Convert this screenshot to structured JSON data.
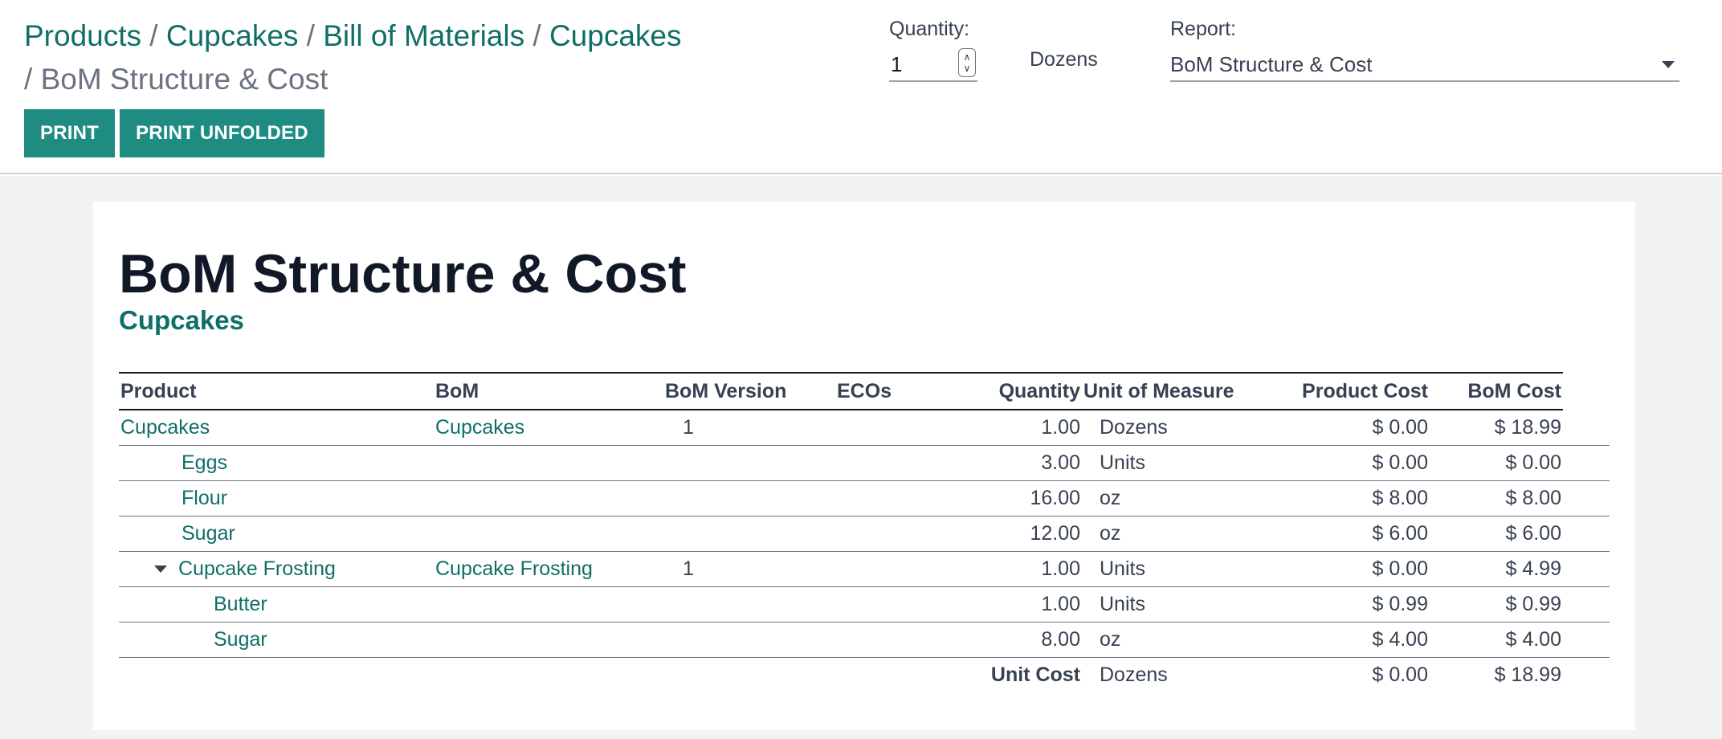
{
  "breadcrumb": {
    "items": [
      "Products",
      "Cupcakes",
      "Bill of Materials",
      "Cupcakes"
    ],
    "separator": "/",
    "current": "BoM Structure & Cost"
  },
  "buttons": {
    "print": "PRINT",
    "print_unfolded": "PRINT UNFOLDED"
  },
  "quantity": {
    "label": "Quantity:",
    "value": "1",
    "uom": "Dozens"
  },
  "report": {
    "label": "Report:",
    "selected": "BoM Structure & Cost"
  },
  "sheet": {
    "title": "BoM Structure & Cost",
    "subtitle": "Cupcakes",
    "columns": {
      "product": "Product",
      "bom": "BoM",
      "bom_version": "BoM Version",
      "ecos": "ECOs",
      "quantity": "Quantity",
      "uom": "Unit of Measure",
      "product_cost": "Product Cost",
      "bom_cost": "BoM Cost"
    },
    "rows": [
      {
        "product": "Cupcakes",
        "bom": "Cupcakes",
        "version": "1",
        "qty": "1.00",
        "uom": "Dozens",
        "product_cost": "$ 0.00",
        "bom_cost": "$ 18.99"
      },
      {
        "product": "Eggs",
        "bom": "",
        "version": "",
        "qty": "3.00",
        "uom": "Units",
        "product_cost": "$ 0.00",
        "bom_cost": "$ 0.00"
      },
      {
        "product": "Flour",
        "bom": "",
        "version": "",
        "qty": "16.00",
        "uom": "oz",
        "product_cost": "$ 8.00",
        "bom_cost": "$ 8.00"
      },
      {
        "product": "Sugar",
        "bom": "",
        "version": "",
        "qty": "12.00",
        "uom": "oz",
        "product_cost": "$ 6.00",
        "bom_cost": "$ 6.00"
      },
      {
        "product": "Cupcake Frosting",
        "bom": "Cupcake Frosting",
        "version": "1",
        "qty": "1.00",
        "uom": "Units",
        "product_cost": "$ 0.00",
        "bom_cost": "$ 4.99"
      },
      {
        "product": "Butter",
        "bom": "",
        "version": "",
        "qty": "1.00",
        "uom": "Units",
        "product_cost": "$ 0.99",
        "bom_cost": "$ 0.99"
      },
      {
        "product": "Sugar",
        "bom": "",
        "version": "",
        "qty": "8.00",
        "uom": "oz",
        "product_cost": "$ 4.00",
        "bom_cost": "$ 4.00"
      }
    ],
    "total": {
      "label": "Unit Cost",
      "uom": "Dozens",
      "product_cost": "$ 0.00",
      "bom_cost": "$ 18.99"
    }
  },
  "colors": {
    "accent": "#0f6f66",
    "button": "#1f8c82",
    "background": "#f1f2f4"
  }
}
